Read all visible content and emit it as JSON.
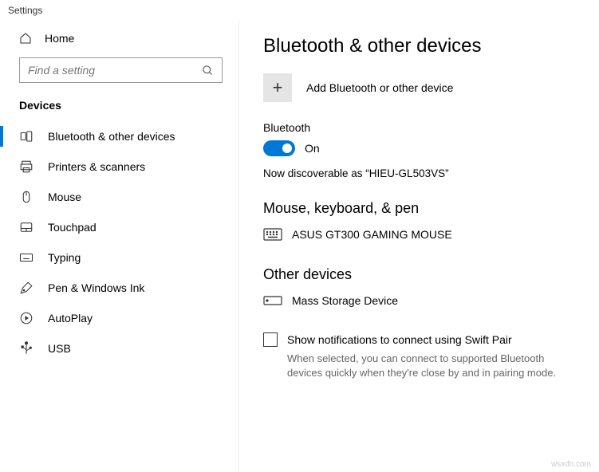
{
  "window": {
    "title": "Settings"
  },
  "sidebar": {
    "home_label": "Home",
    "search_placeholder": "Find a setting",
    "heading": "Devices",
    "items": [
      {
        "label": "Bluetooth & other devices",
        "icon": "bluetooth-devices-icon",
        "active": true
      },
      {
        "label": "Printers & scanners",
        "icon": "printer-icon",
        "active": false
      },
      {
        "label": "Mouse",
        "icon": "mouse-icon",
        "active": false
      },
      {
        "label": "Touchpad",
        "icon": "touchpad-icon",
        "active": false
      },
      {
        "label": "Typing",
        "icon": "keyboard-icon",
        "active": false
      },
      {
        "label": "Pen & Windows Ink",
        "icon": "pen-icon",
        "active": false
      },
      {
        "label": "AutoPlay",
        "icon": "autoplay-icon",
        "active": false
      },
      {
        "label": "USB",
        "icon": "usb-icon",
        "active": false
      }
    ]
  },
  "main": {
    "title": "Bluetooth & other devices",
    "add_label": "Add Bluetooth or other device",
    "bluetooth": {
      "label": "Bluetooth",
      "state": "On",
      "discoverable": "Now discoverable as “HIEU-GL503VS”"
    },
    "mouse_section": {
      "heading": "Mouse, keyboard, & pen",
      "device": "ASUS GT300 GAMING MOUSE"
    },
    "other_section": {
      "heading": "Other devices",
      "device": "Mass Storage Device"
    },
    "swift_pair": {
      "label": "Show notifications to connect using Swift Pair",
      "help": "When selected, you can connect to supported Bluetooth devices quickly when they're close by and in pairing mode."
    }
  },
  "watermark": "wsxdn.com"
}
